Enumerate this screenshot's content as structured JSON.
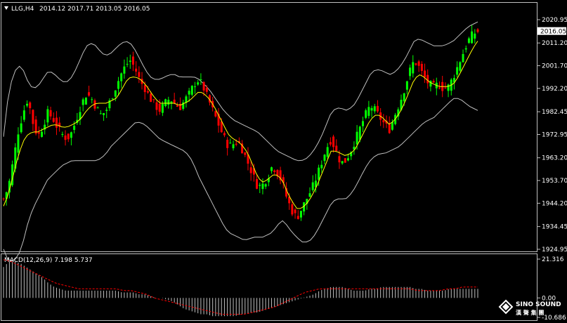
{
  "header": {
    "symbol": "LLG,H4",
    "ohlc": "2014.12 2017.71 2013.05 2016.05"
  },
  "price_axis": {
    "ticks": [
      "2020.95",
      "2011.20",
      "2001.70",
      "1992.20",
      "1982.45",
      "1972.95",
      "1963.20",
      "1953.70",
      "1944.20",
      "1934.45",
      "1924.95"
    ],
    "current": "2016.05"
  },
  "macd": {
    "label": "MACD(12,26,9) 7.198 5.737",
    "ticks": [
      "21.316",
      "0.00",
      "-10.686"
    ]
  },
  "watermark": {
    "brand": "SINO SOUND",
    "sub": "漢 聲 集 團"
  },
  "colors": {
    "background": "#000000",
    "bull": "#00ff00",
    "bear": "#ff0000",
    "ma": "#ffff00",
    "bands": "#c0c0c0",
    "macd_hist": "#c0c0c0",
    "macd_signal": "#ff0000",
    "frame": "#c0c0c0"
  },
  "chart_data": {
    "type": "line",
    "title": "LLG,H4",
    "ylim": [
      1924.95,
      2020.95
    ],
    "close_path": [
      1946,
      1951,
      1962,
      1974,
      1982,
      1988,
      1978,
      1972,
      1976,
      1982,
      1980,
      1976,
      1973,
      1971,
      1974,
      1980,
      1986,
      1990,
      1988,
      1984,
      1981,
      1983,
      1988,
      1993,
      1998,
      2002,
      2004,
      2000,
      1995,
      1992,
      1988,
      1985,
      1983,
      1986,
      1988,
      1986,
      1984,
      1987,
      1990,
      1994,
      1996,
      1992,
      1987,
      1982,
      1977,
      1972,
      1968,
      1969,
      1970,
      1966,
      1961,
      1956,
      1951,
      1952,
      1955,
      1960,
      1957,
      1953,
      1946,
      1941,
      1938,
      1942,
      1946,
      1950,
      1955,
      1961,
      1967,
      1971,
      1966,
      1961,
      1962,
      1966,
      1971,
      1976,
      1981,
      1985,
      1983,
      1980,
      1977,
      1975,
      1981,
      1986,
      1992,
      1999,
      2004,
      2001,
      1997,
      1994,
      1993,
      1994,
      1992,
      1993,
      1997,
      2002,
      2007,
      2012,
      2015,
      2016.05
    ],
    "ma_path": [
      1943,
      1948,
      1956,
      1964,
      1970,
      1973,
      1974,
      1974,
      1975,
      1976,
      1977,
      1977,
      1976,
      1976,
      1977,
      1978,
      1980,
      1983,
      1985,
      1986,
      1986,
      1986,
      1987,
      1988,
      1991,
      1995,
      1997,
      1997,
      1996,
      1994,
      1991,
      1988,
      1986,
      1986,
      1986,
      1986,
      1985,
      1986,
      1987,
      1989,
      1991,
      1990,
      1988,
      1985,
      1981,
      1977,
      1973,
      1971,
      1970,
      1968,
      1965,
      1960,
      1955,
      1953,
      1954,
      1956,
      1956,
      1954,
      1949,
      1945,
      1942,
      1942,
      1944,
      1947,
      1951,
      1956,
      1961,
      1966,
      1966,
      1965,
      1964,
      1965,
      1967,
      1971,
      1975,
      1979,
      1981,
      1981,
      1979,
      1977,
      1979,
      1982,
      1986,
      1991,
      1996,
      1998,
      1997,
      1995,
      1994,
      1993,
      1993,
      1993,
      1994,
      1997,
      2001,
      2005,
      2009,
      2012
    ],
    "band_upper": [
      1972,
      1990,
      1998,
      2002,
      2000,
      1995,
      1992,
      1993,
      1996,
      1999,
      1999,
      1997,
      1995,
      1995,
      1997,
      2001,
      2006,
      2010,
      2011,
      2010,
      2007,
      2006,
      2007,
      2009,
      2011,
      2012,
      2011,
      2008,
      2004,
      2000,
      1997,
      1996,
      1996,
      1997,
      1998,
      1998,
      1997,
      1997,
      1997,
      1997,
      1996,
      1994,
      1992,
      1989,
      1986,
      1983,
      1981,
      1979,
      1978,
      1977,
      1976,
      1975,
      1974,
      1972,
      1970,
      1968,
      1966,
      1965,
      1964,
      1963,
      1962,
      1962,
      1963,
      1965,
      1968,
      1972,
      1977,
      1982,
      1984,
      1984,
      1983,
      1984,
      1986,
      1990,
      1994,
      1998,
      2000,
      2000,
      1999,
      1998,
      1999,
      2001,
      2004,
      2008,
      2012,
      2013,
      2012,
      2011,
      2010,
      2010,
      2010,
      2011,
      2012,
      2014,
      2016,
      2018,
      2019,
      2020
    ],
    "band_lower": [
      1925,
      1920,
      1920,
      1922,
      1928,
      1936,
      1942,
      1946,
      1950,
      1954,
      1956,
      1958,
      1960,
      1961,
      1962,
      1962,
      1962,
      1962,
      1962,
      1962,
      1963,
      1965,
      1968,
      1970,
      1972,
      1974,
      1976,
      1978,
      1978,
      1977,
      1975,
      1973,
      1971,
      1970,
      1969,
      1968,
      1967,
      1966,
      1964,
      1960,
      1955,
      1951,
      1947,
      1943,
      1939,
      1935,
      1932,
      1931,
      1930,
      1929,
      1929,
      1930,
      1930,
      1930,
      1931,
      1932,
      1935,
      1937,
      1935,
      1932,
      1930,
      1928,
      1928,
      1929,
      1932,
      1936,
      1940,
      1944,
      1946,
      1946,
      1946,
      1948,
      1951,
      1955,
      1959,
      1962,
      1964,
      1965,
      1965,
      1966,
      1967,
      1968,
      1970,
      1972,
      1974,
      1976,
      1978,
      1979,
      1980,
      1982,
      1984,
      1986,
      1988,
      1988,
      1987,
      1985,
      1984,
      1983
    ],
    "macd_hist": [
      17,
      20,
      20,
      19,
      17,
      15,
      13,
      11,
      8,
      6,
      5,
      4,
      4,
      4,
      4,
      4,
      4,
      4,
      4,
      4,
      4,
      3,
      3,
      3,
      2,
      2,
      1,
      0,
      0,
      -1,
      -2,
      -4,
      -6,
      -7,
      -8,
      -9,
      -9,
      -10,
      -10,
      -10,
      -10,
      -10,
      -9,
      -9,
      -8,
      -8,
      -7,
      -6,
      -5,
      -4,
      -3,
      -2,
      -1,
      0,
      1,
      2,
      4,
      5,
      6,
      6,
      6,
      5,
      4,
      4,
      4,
      5,
      5,
      6,
      6,
      6,
      6,
      6,
      6,
      5,
      5,
      4,
      4,
      4,
      4,
      5,
      5,
      5,
      5,
      5,
      5
    ],
    "macd_signal": [
      21,
      20,
      18,
      16,
      14,
      12,
      10,
      8,
      7,
      6,
      5,
      5,
      5,
      5,
      5,
      5,
      4,
      4,
      3,
      2,
      0,
      -1,
      -2,
      -3,
      -4,
      -5,
      -6,
      -7,
      -8,
      -9,
      -9,
      -9,
      -9,
      -8,
      -7,
      -6,
      -5,
      -3,
      -1,
      1,
      3,
      4,
      5,
      5,
      5,
      5,
      5,
      5,
      5,
      5,
      5,
      5,
      5,
      5,
      5,
      4,
      4,
      4,
      4,
      5,
      5,
      6,
      6,
      6
    ]
  }
}
